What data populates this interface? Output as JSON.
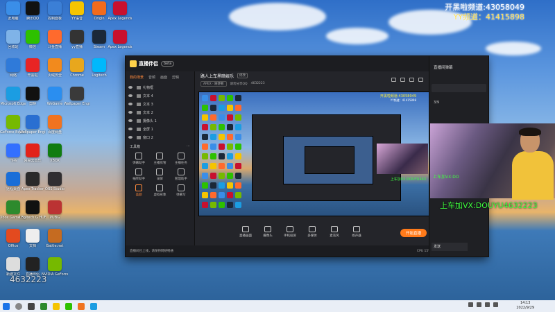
{
  "overlay": {
    "line1": "开黑啦频道:43058049",
    "line2": "YY频道：41415898"
  },
  "desktop_icons": [
    {
      "label": "此电脑",
      "color": "#3a8ee8"
    },
    {
      "label": "腾讯QQ",
      "color": "#111"
    },
    {
      "label": "控制面板",
      "color": "#3b7fd6"
    },
    {
      "label": "YY语音",
      "color": "#f5c400"
    },
    {
      "label": "Origin",
      "color": "#f26b1d"
    },
    {
      "label": "Apex Legends",
      "color": "#c8102e"
    },
    {
      "label": "回收站",
      "color": "#7fb3e8"
    },
    {
      "label": "微信",
      "color": "#2dc100"
    },
    {
      "label": "斗鱼直播",
      "color": "#ff6a2d"
    },
    {
      "label": "yy直播",
      "color": "#333"
    },
    {
      "label": "Steam",
      "color": "#1b2838"
    },
    {
      "label": "Apex Legends",
      "color": "#c8102e"
    },
    {
      "label": "网络",
      "color": "#2f7ad9"
    },
    {
      "label": "开黑啦",
      "color": "#e82424"
    },
    {
      "label": "火绒安全",
      "color": "#f28a1d"
    },
    {
      "label": "Chrome",
      "color": "#e8a71d"
    },
    {
      "label": "Logitech",
      "color": "#00b8fc"
    },
    {
      "label": "Microsoft Edge",
      "color": "#1b9de2"
    },
    {
      "label": "剪映",
      "color": "#111"
    },
    {
      "label": "WeGame",
      "color": "#2a8ef0"
    },
    {
      "label": "Wallpaper Engine",
      "color": "#3a3a3a"
    },
    {
      "label": "GeForce Experience",
      "color": "#76b900"
    },
    {
      "label": "Wallpaper Engine",
      "color": "#2a6fd1"
    },
    {
      "label": "百度网盘",
      "color": "#f07320"
    },
    {
      "label": "飞书",
      "color": "#3370ff"
    },
    {
      "label": "网易云音乐",
      "color": "#e2231a"
    },
    {
      "label": "XBOX",
      "color": "#107c10"
    },
    {
      "label": "远程桌面",
      "color": "#1a6ed8"
    },
    {
      "label": "Apex Tracker",
      "color": "#2a2a2a"
    },
    {
      "label": "OBS Studio",
      "color": "#302e31"
    },
    {
      "label": "Xbox Game Bar",
      "color": "#2d8a2d"
    },
    {
      "label": "Logitech G HUB",
      "color": "#111"
    },
    {
      "label": "PUBG",
      "color": "#b33"
    },
    {
      "label": "Office",
      "color": "#e34a1f"
    },
    {
      "label": "文档",
      "color": "#eee"
    },
    {
      "label": "Battle.net",
      "color": "#c56b21"
    },
    {
      "label": "新建文件",
      "color": "#ddd"
    },
    {
      "label": "直播伴侣",
      "color": "#222"
    },
    {
      "label": "NVIDIA GeForce",
      "color": "#76b900"
    }
  ],
  "app": {
    "brand": "直播伴侣",
    "version": "beta",
    "left_tabs": [
      "我的场景",
      "音频",
      "画面",
      "剪辑"
    ],
    "sources": [
      "礼物框",
      "文本 4",
      "文本 3",
      "文本 2",
      "摄像头 1",
      "全屏 1",
      "窗口 2"
    ],
    "tools_header": "工具箱",
    "tools": [
      "弹幕助手",
      "主播房管",
      "主播任务",
      "抽奖助手",
      "录屏",
      "管理助手",
      "美颜",
      "虚拟形象",
      "弹幕写"
    ],
    "room_title": "路人上车黑暗娱乐",
    "room_tag": "修改",
    "room_cat": "APEX · 随便看",
    "room_info": "请勿分享QQ",
    "room_id": "4632223",
    "bottom_buttons": [
      "直播画面",
      "摄像头",
      "手机投屏",
      "多媒体",
      "麦克风",
      "扬声器"
    ],
    "start_label": "开始直播",
    "status_left": "直播间已上线，请保持网络畅通",
    "status_stats": [
      "CPU 15%",
      "GPU 29%",
      "FPS 60",
      "00:00:00"
    ]
  },
  "preview": {
    "cam_text": "上车加VX:DOUYU463",
    "channel1": "开黑啦频道:43058049",
    "channel2": "YY频道：41415898"
  },
  "chat": {
    "head": "直播间弹幕",
    "date": "3/9",
    "input": "发送"
  },
  "cam": {
    "text": "上车加VX:DOUYU4632223",
    "small_text": "上车加VX:DO"
  },
  "taskbar": {
    "time": "14:13",
    "date": "2022/9/29"
  },
  "watermark": "4632223"
}
